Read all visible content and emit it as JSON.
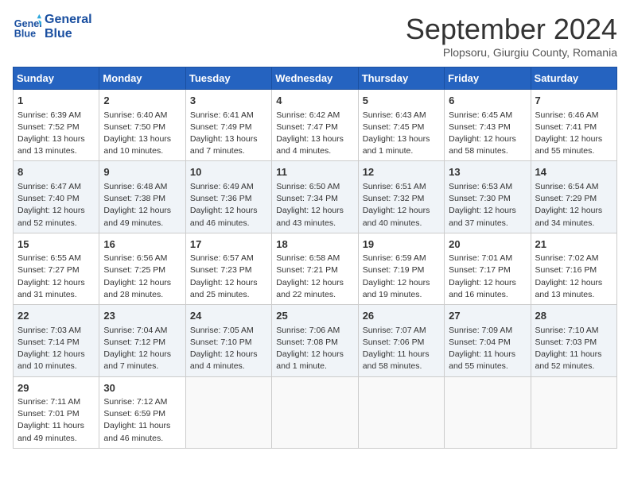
{
  "header": {
    "logo_line1": "General",
    "logo_line2": "Blue",
    "month": "September 2024",
    "location": "Plopsoru, Giurgiu County, Romania"
  },
  "weekdays": [
    "Sunday",
    "Monday",
    "Tuesday",
    "Wednesday",
    "Thursday",
    "Friday",
    "Saturday"
  ],
  "weeks": [
    [
      {
        "day": "1",
        "info": "Sunrise: 6:39 AM\nSunset: 7:52 PM\nDaylight: 13 hours\nand 13 minutes."
      },
      {
        "day": "2",
        "info": "Sunrise: 6:40 AM\nSunset: 7:50 PM\nDaylight: 13 hours\nand 10 minutes."
      },
      {
        "day": "3",
        "info": "Sunrise: 6:41 AM\nSunset: 7:49 PM\nDaylight: 13 hours\nand 7 minutes."
      },
      {
        "day": "4",
        "info": "Sunrise: 6:42 AM\nSunset: 7:47 PM\nDaylight: 13 hours\nand 4 minutes."
      },
      {
        "day": "5",
        "info": "Sunrise: 6:43 AM\nSunset: 7:45 PM\nDaylight: 13 hours\nand 1 minute."
      },
      {
        "day": "6",
        "info": "Sunrise: 6:45 AM\nSunset: 7:43 PM\nDaylight: 12 hours\nand 58 minutes."
      },
      {
        "day": "7",
        "info": "Sunrise: 6:46 AM\nSunset: 7:41 PM\nDaylight: 12 hours\nand 55 minutes."
      }
    ],
    [
      {
        "day": "8",
        "info": "Sunrise: 6:47 AM\nSunset: 7:40 PM\nDaylight: 12 hours\nand 52 minutes."
      },
      {
        "day": "9",
        "info": "Sunrise: 6:48 AM\nSunset: 7:38 PM\nDaylight: 12 hours\nand 49 minutes."
      },
      {
        "day": "10",
        "info": "Sunrise: 6:49 AM\nSunset: 7:36 PM\nDaylight: 12 hours\nand 46 minutes."
      },
      {
        "day": "11",
        "info": "Sunrise: 6:50 AM\nSunset: 7:34 PM\nDaylight: 12 hours\nand 43 minutes."
      },
      {
        "day": "12",
        "info": "Sunrise: 6:51 AM\nSunset: 7:32 PM\nDaylight: 12 hours\nand 40 minutes."
      },
      {
        "day": "13",
        "info": "Sunrise: 6:53 AM\nSunset: 7:30 PM\nDaylight: 12 hours\nand 37 minutes."
      },
      {
        "day": "14",
        "info": "Sunrise: 6:54 AM\nSunset: 7:29 PM\nDaylight: 12 hours\nand 34 minutes."
      }
    ],
    [
      {
        "day": "15",
        "info": "Sunrise: 6:55 AM\nSunset: 7:27 PM\nDaylight: 12 hours\nand 31 minutes."
      },
      {
        "day": "16",
        "info": "Sunrise: 6:56 AM\nSunset: 7:25 PM\nDaylight: 12 hours\nand 28 minutes."
      },
      {
        "day": "17",
        "info": "Sunrise: 6:57 AM\nSunset: 7:23 PM\nDaylight: 12 hours\nand 25 minutes."
      },
      {
        "day": "18",
        "info": "Sunrise: 6:58 AM\nSunset: 7:21 PM\nDaylight: 12 hours\nand 22 minutes."
      },
      {
        "day": "19",
        "info": "Sunrise: 6:59 AM\nSunset: 7:19 PM\nDaylight: 12 hours\nand 19 minutes."
      },
      {
        "day": "20",
        "info": "Sunrise: 7:01 AM\nSunset: 7:17 PM\nDaylight: 12 hours\nand 16 minutes."
      },
      {
        "day": "21",
        "info": "Sunrise: 7:02 AM\nSunset: 7:16 PM\nDaylight: 12 hours\nand 13 minutes."
      }
    ],
    [
      {
        "day": "22",
        "info": "Sunrise: 7:03 AM\nSunset: 7:14 PM\nDaylight: 12 hours\nand 10 minutes."
      },
      {
        "day": "23",
        "info": "Sunrise: 7:04 AM\nSunset: 7:12 PM\nDaylight: 12 hours\nand 7 minutes."
      },
      {
        "day": "24",
        "info": "Sunrise: 7:05 AM\nSunset: 7:10 PM\nDaylight: 12 hours\nand 4 minutes."
      },
      {
        "day": "25",
        "info": "Sunrise: 7:06 AM\nSunset: 7:08 PM\nDaylight: 12 hours\nand 1 minute."
      },
      {
        "day": "26",
        "info": "Sunrise: 7:07 AM\nSunset: 7:06 PM\nDaylight: 11 hours\nand 58 minutes."
      },
      {
        "day": "27",
        "info": "Sunrise: 7:09 AM\nSunset: 7:04 PM\nDaylight: 11 hours\nand 55 minutes."
      },
      {
        "day": "28",
        "info": "Sunrise: 7:10 AM\nSunset: 7:03 PM\nDaylight: 11 hours\nand 52 minutes."
      }
    ],
    [
      {
        "day": "29",
        "info": "Sunrise: 7:11 AM\nSunset: 7:01 PM\nDaylight: 11 hours\nand 49 minutes."
      },
      {
        "day": "30",
        "info": "Sunrise: 7:12 AM\nSunset: 6:59 PM\nDaylight: 11 hours\nand 46 minutes."
      },
      {
        "day": "",
        "info": ""
      },
      {
        "day": "",
        "info": ""
      },
      {
        "day": "",
        "info": ""
      },
      {
        "day": "",
        "info": ""
      },
      {
        "day": "",
        "info": ""
      }
    ]
  ]
}
